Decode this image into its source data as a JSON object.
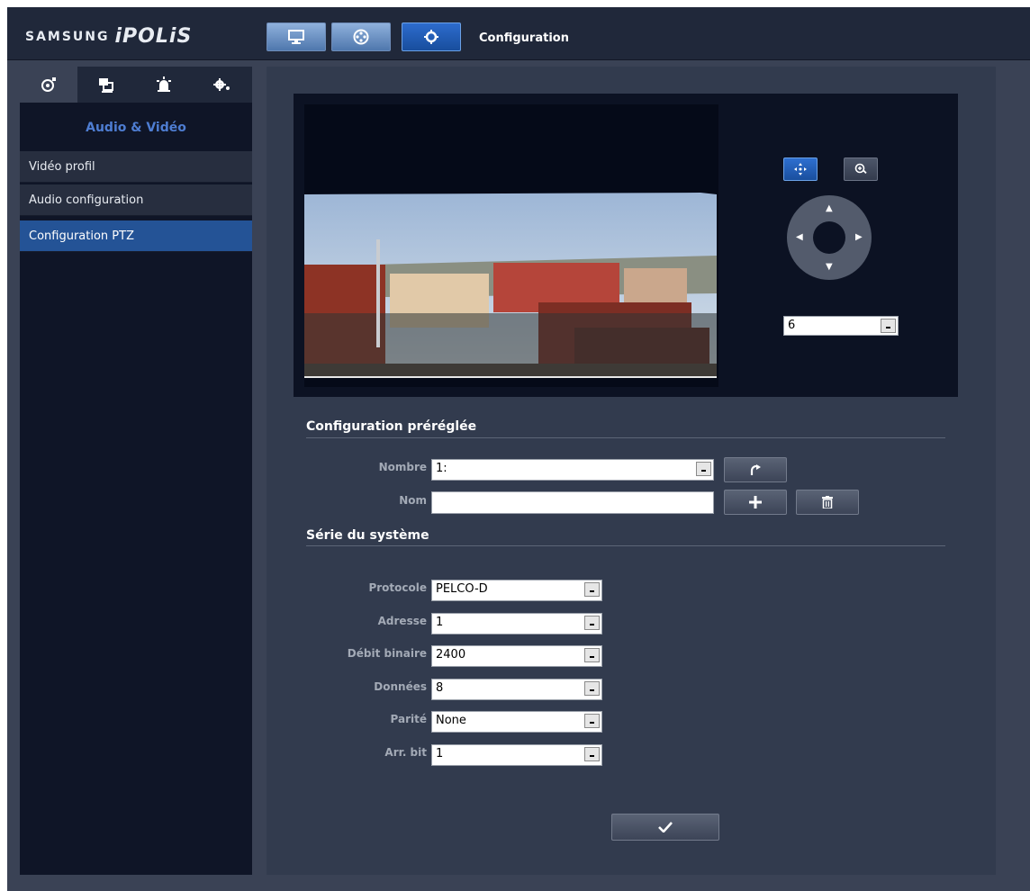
{
  "header": {
    "brand": "SAMSUNG",
    "product": "iPOLiS",
    "title": "Configuration"
  },
  "sidebar": {
    "section_title": "Audio & Vidéo",
    "items": [
      {
        "label": "Vidéo profil"
      },
      {
        "label": "Audio configuration"
      },
      {
        "label": "Configuration PTZ"
      }
    ]
  },
  "ptz": {
    "speed_value": "6"
  },
  "preset": {
    "title": "Configuration préréglée",
    "number_label": "Nombre",
    "number_value": "1:",
    "name_label": "Nom",
    "name_value": ""
  },
  "serial": {
    "title": "Série du système",
    "fields": [
      {
        "label": "Protocole",
        "value": "PELCO-D"
      },
      {
        "label": "Adresse",
        "value": "1"
      },
      {
        "label": "Débit binaire",
        "value": "2400"
      },
      {
        "label": "Données",
        "value": "8"
      },
      {
        "label": "Parité",
        "value": "None"
      },
      {
        "label": "Arr. bit",
        "value": "1"
      }
    ]
  },
  "colors": {
    "accent_blue": "#245396",
    "section_blue": "#4e7dd2",
    "panel_bg": "#323b4e"
  }
}
